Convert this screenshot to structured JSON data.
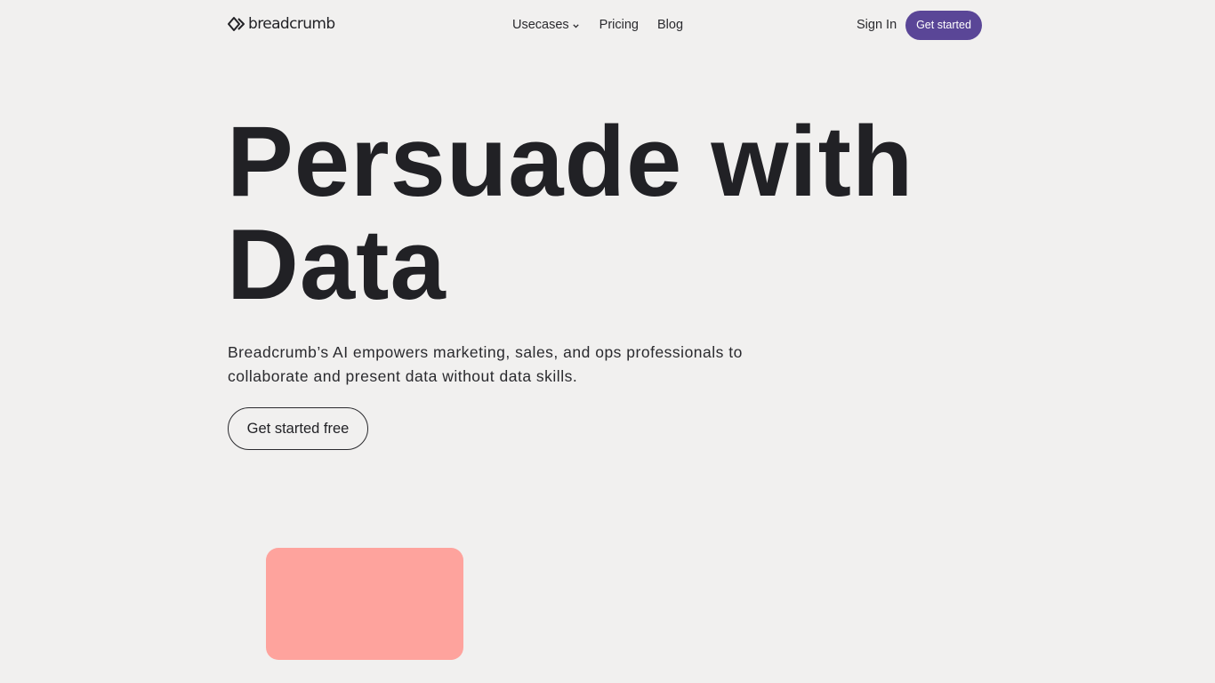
{
  "header": {
    "logo_text": "breadcrumb",
    "logo_icon": "breadcrumb-logo-icon",
    "nav": [
      {
        "label": "Usecases",
        "has_dropdown": true
      },
      {
        "label": "Pricing"
      },
      {
        "label": "Blog"
      }
    ],
    "sign_in_label": "Sign In",
    "get_started_label": "Get started"
  },
  "hero": {
    "title_line1": "Persuade with",
    "title_line2": "Data",
    "subtitle_line1": "Breadcrumb’s AI empowers marketing, sales, and ops professionals to",
    "subtitle_line2": "collaborate and present data without data skills.",
    "cta_label": "Get started free"
  },
  "colors": {
    "background": "#f1f0ef",
    "accent": "#5a4697",
    "text": "#212125",
    "card": "#fea39d"
  }
}
